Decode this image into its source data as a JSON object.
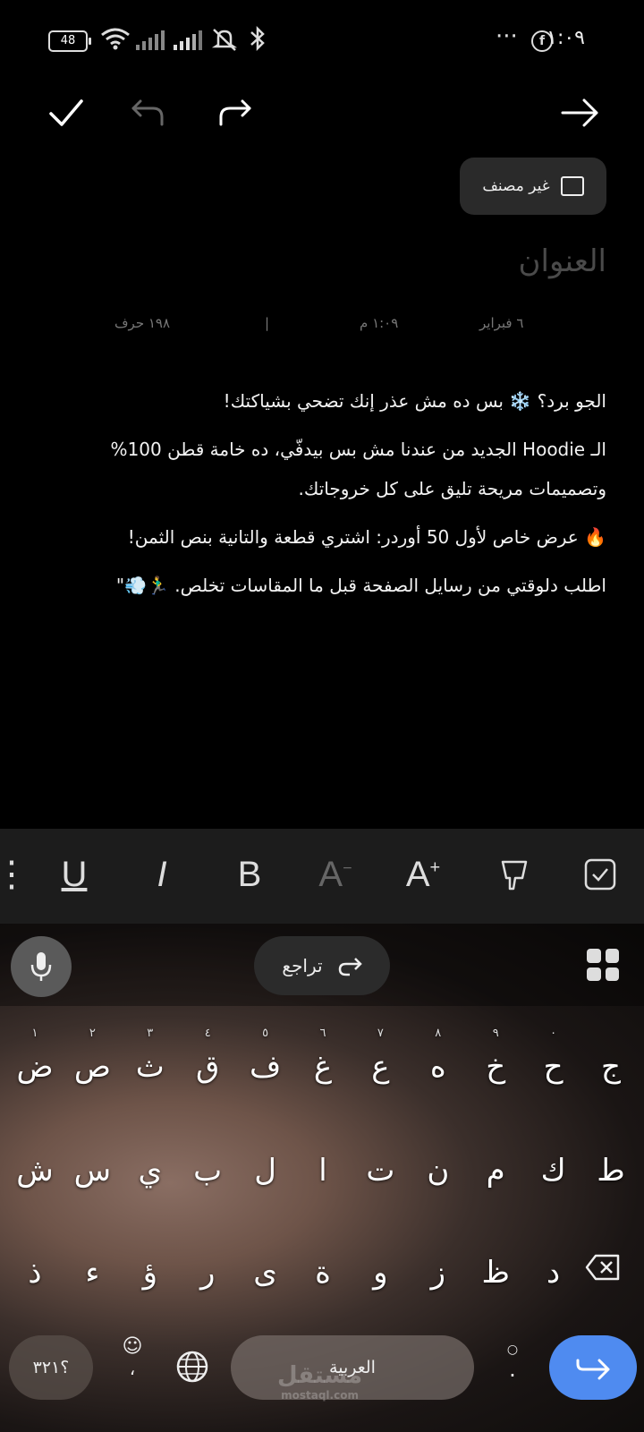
{
  "status_bar": {
    "battery": "48",
    "time": "١:٠٩",
    "icons": [
      "wifi-icon",
      "signal-icon",
      "signal-icon",
      "silent-icon",
      "bluetooth-icon",
      "more-dots-icon",
      "facebook-icon"
    ]
  },
  "toolbar": {
    "buttons": [
      "check-icon",
      "undo-icon",
      "redo-icon",
      "forward-arrow-icon"
    ]
  },
  "category": {
    "label": "غير مصنف"
  },
  "note": {
    "title_placeholder": "العنوان",
    "date": "٦ فبراير",
    "time": "١:٠٩ م",
    "separator": "|",
    "char_count": "١٩٨ حرف",
    "paragraphs": [
      "الجو برد؟ ❄️ بس ده مش عذر إنك تضحي بشياكتك!",
      "الـ Hoodie الجديد من عندنا مش بس بيدفّي، ده خامة قطن 100% وتصميمات مريحة تليق على كل خروجاتك.",
      "🔥 عرض خاص لأول 50 أوردر: اشتري قطعة والتانية بنص الثمن!",
      "اطلب دلوقتي من رسايل الصفحة قبل ما المقاسات تخلص. 🏃‍♂️💨\""
    ]
  },
  "format_bar": {
    "items": [
      "checkbox-icon",
      "highlighter-icon",
      "font-size-increase-icon",
      "font-size-decrease-icon",
      "bold-icon",
      "italic-icon",
      "underline-icon",
      "more-icon"
    ]
  },
  "keyboard": {
    "undo_label": "تراجع",
    "row1": [
      {
        "ch": "ض",
        "num": "١"
      },
      {
        "ch": "ص",
        "num": "٢"
      },
      {
        "ch": "ث",
        "num": "٣"
      },
      {
        "ch": "ق",
        "num": "٤"
      },
      {
        "ch": "ف",
        "num": "٥"
      },
      {
        "ch": "غ",
        "num": "٦"
      },
      {
        "ch": "ع",
        "num": "٧"
      },
      {
        "ch": "ه",
        "num": "٨"
      },
      {
        "ch": "خ",
        "num": "٩"
      },
      {
        "ch": "ح",
        "num": "٠"
      },
      {
        "ch": "ج",
        "num": ""
      }
    ],
    "row2": [
      "ش",
      "س",
      "ي",
      "ب",
      "ل",
      "ا",
      "ت",
      "ن",
      "م",
      "ك",
      "ط"
    ],
    "row3": [
      "ذ",
      "ء",
      "ؤ",
      "ر",
      "ى",
      "ة",
      "و",
      "ز",
      "ظ",
      "د"
    ],
    "symbols_label": "؟٣٢١",
    "emoji_comma": "،",
    "space_label": "العربية",
    "period_label": ".",
    "watermark": "مستقل",
    "watermark_sub": "mostaql.com"
  }
}
